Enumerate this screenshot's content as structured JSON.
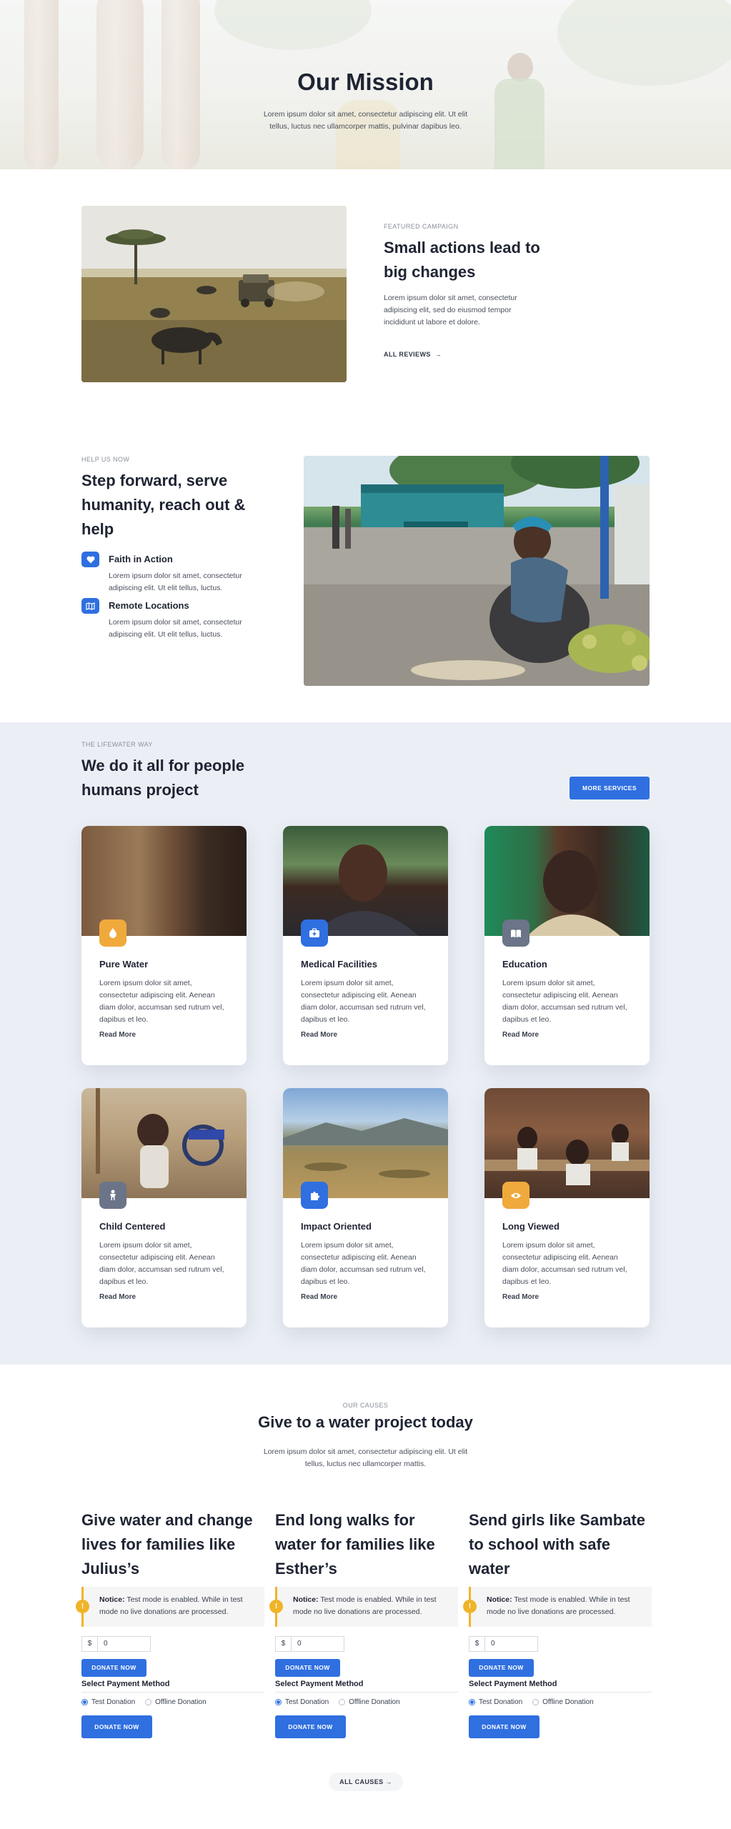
{
  "hero": {
    "title": "Our Mission",
    "subtitle": "Lorem ipsum dolor sit amet, consectetur adipiscing elit. Ut elit tellus, luctus nec ullamcorper mattis, pulvinar dapibus leo."
  },
  "featured": {
    "eyebrow": "FEATURED CAMPAIGN",
    "title": "Small actions lead to big changes",
    "text": "Lorem ipsum dolor sit amet, consectetur adipiscing elit, sed do eiusmod tempor incididunt ut labore et dolore.",
    "link_label": "ALL REVIEWS",
    "link_arrow": "→"
  },
  "help": {
    "eyebrow": "HELP US NOW",
    "title": "Step forward, serve humanity, reach out & help",
    "items": [
      {
        "title": "Faith in Action",
        "text": "Lorem ipsum dolor sit amet, consectetur adipiscing elit. Ut elit tellus, luctus.",
        "icon": "heart-icon"
      },
      {
        "title": "Remote Locations",
        "text": "Lorem ipsum dolor sit amet, consectetur adipiscing elit. Ut elit tellus, luctus.",
        "icon": "map-icon"
      }
    ]
  },
  "services": {
    "eyebrow": "THE LIFEWATER WAY",
    "title": "We do it all for people humans project",
    "button_label": "MORE SERVICES",
    "cards": [
      {
        "title": "Pure Water",
        "text": "Lorem ipsum dolor sit amet, consectetur adipiscing elit. Aenean diam dolor, accumsan sed rutrum vel, dapibus et leo.",
        "link": "Read More",
        "icon": "water-drop-icon",
        "badge_color": "#f0a93b"
      },
      {
        "title": "Medical Facilities",
        "text": "Lorem ipsum dolor sit amet, consectetur adipiscing elit. Aenean diam dolor, accumsan sed rutrum vel, dapibus et leo.",
        "link": "Read More",
        "icon": "medical-kit-icon",
        "badge_color": "#2f6fe0"
      },
      {
        "title": "Education",
        "text": "Lorem ipsum dolor sit amet, consectetur adipiscing elit. Aenean diam dolor, accumsan sed rutrum vel, dapibus et leo.",
        "link": "Read More",
        "icon": "book-icon",
        "badge_color": "#6b7488"
      },
      {
        "title": "Child Centered",
        "text": "Lorem ipsum dolor sit amet, consectetur adipiscing elit. Aenean diam dolor, accumsan sed rutrum vel, dapibus et leo.",
        "link": "Read More",
        "icon": "child-icon",
        "badge_color": "#6b7488"
      },
      {
        "title": "Impact Oriented",
        "text": "Lorem ipsum dolor sit amet, consectetur adipiscing elit. Aenean diam dolor, accumsan sed rutrum vel, dapibus et leo.",
        "link": "Read More",
        "icon": "puzzle-icon",
        "badge_color": "#2f6fe0"
      },
      {
        "title": "Long Viewed",
        "text": "Lorem ipsum dolor sit amet, consectetur adipiscing elit. Aenean diam dolor, accumsan sed rutrum vel, dapibus et leo.",
        "link": "Read More",
        "icon": "eye-icon",
        "badge_color": "#f0a93b"
      }
    ]
  },
  "causes": {
    "eyebrow": "OUR CAUSES",
    "title": "Give to a water project today",
    "subtitle": "Lorem ipsum dolor sit amet, consectetur adipiscing elit. Ut elit tellus, luctus nec ullamcorper mattis.",
    "notice_label": "Notice:",
    "notice_text": "Test mode is enabled. While in test mode no live donations are processed.",
    "currency": "$",
    "amount": "0",
    "donate_label": "DONATE NOW",
    "payment_label": "Select Payment Method",
    "payment_options": [
      "Test Donation",
      "Offline Donation"
    ],
    "selected_payment": "Test Donation",
    "items": [
      {
        "title": "Give water and change lives for families like Julius’s"
      },
      {
        "title": "End long walks for water for families like Esther’s"
      },
      {
        "title": "Send girls like Sambate to school with safe water"
      }
    ],
    "all_label": "ALL CAUSES",
    "all_arrow": "→"
  },
  "colors": {
    "primary": "#2f6fe0",
    "accent_orange": "#f0a93b",
    "accent_gray": "#6b7488",
    "warning": "#f0b429",
    "section_bg": "#ebeff5"
  }
}
